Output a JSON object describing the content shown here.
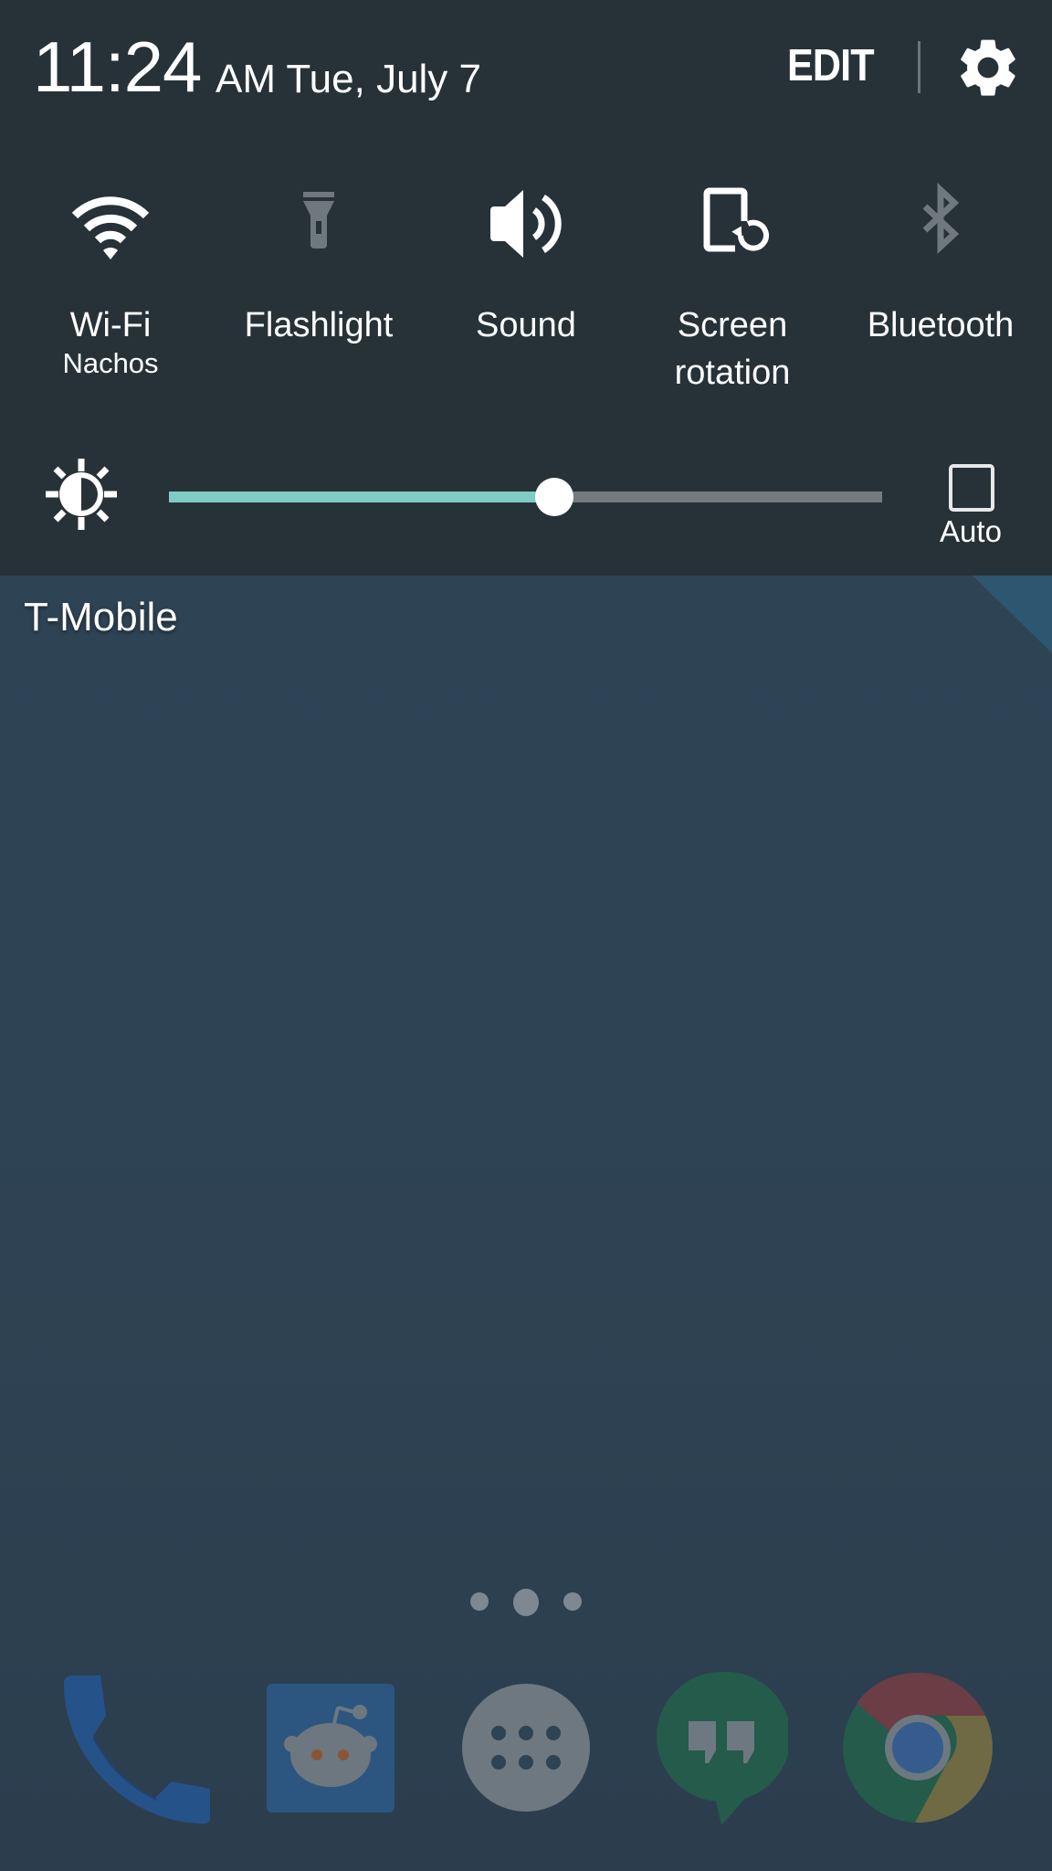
{
  "status": {
    "time": "11:24",
    "date": "AM Tue, July 7"
  },
  "header": {
    "edit_label": "EDIT",
    "settings_icon": "gear-icon"
  },
  "quick_settings": [
    {
      "label": "Wi-Fi",
      "sublabel": "Nachos",
      "icon": "wifi-icon",
      "active": true
    },
    {
      "label": "Flashlight",
      "sublabel": "",
      "icon": "flashlight-icon",
      "active": false
    },
    {
      "label": "Sound",
      "sublabel": "",
      "icon": "volume-icon",
      "active": true
    },
    {
      "label": "Screen rotation",
      "label_line1": "Screen",
      "label_line2": "rotation",
      "icon": "screen-rotation-icon",
      "active": true
    },
    {
      "label": "Bluetooth",
      "sublabel": "",
      "icon": "bluetooth-icon",
      "active": false
    }
  ],
  "brightness": {
    "icon": "brightness-icon",
    "level": 0.54,
    "auto_label": "Auto",
    "auto_checked": false
  },
  "carrier": "T-Mobile",
  "home": {
    "page_indicator": {
      "pages": 3,
      "current": 2
    },
    "dock": [
      {
        "name": "Phone",
        "icon": "phone-icon"
      },
      {
        "name": "Reddit",
        "icon": "reddit-icon"
      },
      {
        "name": "Apps",
        "icon": "app-drawer-icon"
      },
      {
        "name": "Hangouts",
        "icon": "hangouts-icon"
      },
      {
        "name": "Chrome",
        "icon": "chrome-icon"
      }
    ]
  },
  "colors": {
    "shade_bg": "#263238",
    "accent": "#80cbc4",
    "inactive_icon": "#6f787d",
    "wallpaper": "#2e4354"
  }
}
